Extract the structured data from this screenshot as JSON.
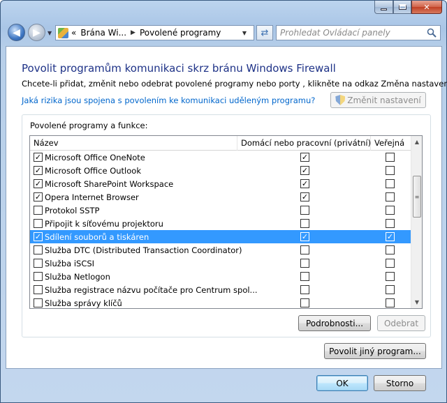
{
  "nav": {
    "back_label": "Zpět",
    "forward_label": "Vpřed",
    "breadcrumb": [
      "Brána Wi...",
      "Povolené programy"
    ],
    "search_placeholder": "Prohledat Ovládací panely"
  },
  "main": {
    "title": "Povolit programům komunikaci skrz bránu Windows Firewall",
    "description": "Chcete-li přidat, změnit nebo odebrat povolené programy nebo porty , klikněte na odkaz Změna nastavení.",
    "risk_link": "Jaká rizika jsou spojena s povolením ke komunikaci uděleným programu?",
    "change_settings_label": "Změnit nastavení",
    "group_label": "Povolené programy a funkce:",
    "columns": [
      "Název",
      "Domácí nebo pracovní (privátní)",
      "Veřejná"
    ],
    "rows": [
      {
        "name": "Microsoft Office OneNote",
        "enabled": true,
        "home": true,
        "public": false,
        "selected": false
      },
      {
        "name": "Microsoft Office Outlook",
        "enabled": true,
        "home": true,
        "public": false,
        "selected": false
      },
      {
        "name": "Microsoft SharePoint Workspace",
        "enabled": true,
        "home": true,
        "public": false,
        "selected": false
      },
      {
        "name": "Opera Internet Browser",
        "enabled": true,
        "home": true,
        "public": false,
        "selected": false
      },
      {
        "name": "Protokol SSTP",
        "enabled": false,
        "home": false,
        "public": false,
        "selected": false
      },
      {
        "name": "Připojit k síťovému projektoru",
        "enabled": false,
        "home": false,
        "public": false,
        "selected": false
      },
      {
        "name": "Sdílení souborů a tiskáren",
        "enabled": true,
        "home": true,
        "public": true,
        "selected": true
      },
      {
        "name": "Služba DTC (Distributed Transaction Coordinator)",
        "enabled": false,
        "home": false,
        "public": false,
        "selected": false
      },
      {
        "name": "Služba iSCSI",
        "enabled": false,
        "home": false,
        "public": false,
        "selected": false
      },
      {
        "name": "Služba Netlogon",
        "enabled": false,
        "home": false,
        "public": false,
        "selected": false
      },
      {
        "name": "Služba registrace názvu počítače pro Centrum spol...",
        "enabled": false,
        "home": false,
        "public": false,
        "selected": false
      },
      {
        "name": "Služba správy klíčů",
        "enabled": false,
        "home": false,
        "public": false,
        "selected": false
      }
    ],
    "details_label": "Podrobnosti...",
    "remove_label": "Odebrat",
    "allow_other_label": "Povolit jiný program..."
  },
  "footer": {
    "ok_label": "OK",
    "cancel_label": "Storno"
  },
  "colors": {
    "selection": "#3399ff",
    "title": "#1e3287",
    "link": "#0066cc"
  }
}
